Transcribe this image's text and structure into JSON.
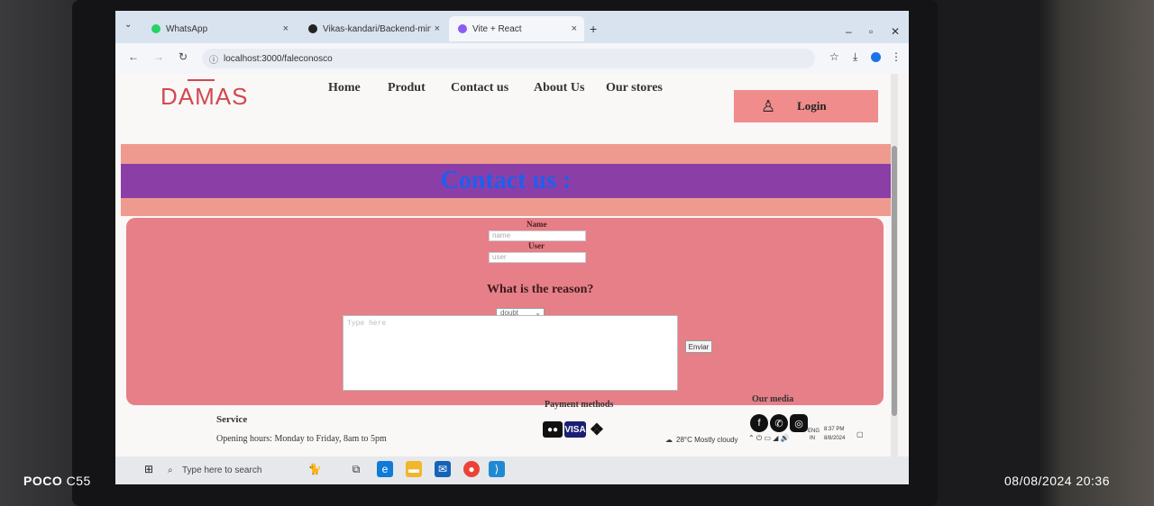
{
  "browser": {
    "tabs": [
      {
        "label": "WhatsApp",
        "color": "#25d366"
      },
      {
        "label": "Vikas-kandari/Backend-mini-p",
        "color": "#222222"
      },
      {
        "label": "Vite + React",
        "color": "#8b5cf6"
      }
    ],
    "new_tab": "+",
    "url": "localhost:3000/faleconosco"
  },
  "site": {
    "logo": "DAMAS",
    "nav": [
      "Home",
      "Produt",
      "Contact us",
      "About Us",
      "Our stores"
    ],
    "login": "Login",
    "banner_title": "Contact us :",
    "form": {
      "name_label": "Name",
      "name_placeholder": "name",
      "user_label": "User",
      "user_placeholder": "user",
      "reason_heading": "What is the reason?",
      "reason_selected": "doubt",
      "message_placeholder": "Type here",
      "submit": "Enviar"
    },
    "footer": {
      "service_heading": "Service",
      "service_hours": "Opening hours: Monday to Friday, 8am to 5pm",
      "payment_heading": "Payment methods",
      "payment_visa": "VISA",
      "media_heading": "Our media"
    },
    "colors": {
      "salmon": "#ef9a8f",
      "purple": "#8b3fa6",
      "title_blue": "#1e5ef0",
      "panel": "#e67f88",
      "logo": "#d0494f"
    }
  },
  "taskbar": {
    "search_placeholder": "Type here to search",
    "weather": "28°C  Mostly cloudy",
    "lang": "ENG",
    "lang_sub": "IN",
    "time": "8:37 PM",
    "date": "8/8/2024"
  },
  "photo_overlay": {
    "brand_bold": "POCO",
    "brand_model": " C55",
    "datetime": "08/08/2024  20:36"
  }
}
